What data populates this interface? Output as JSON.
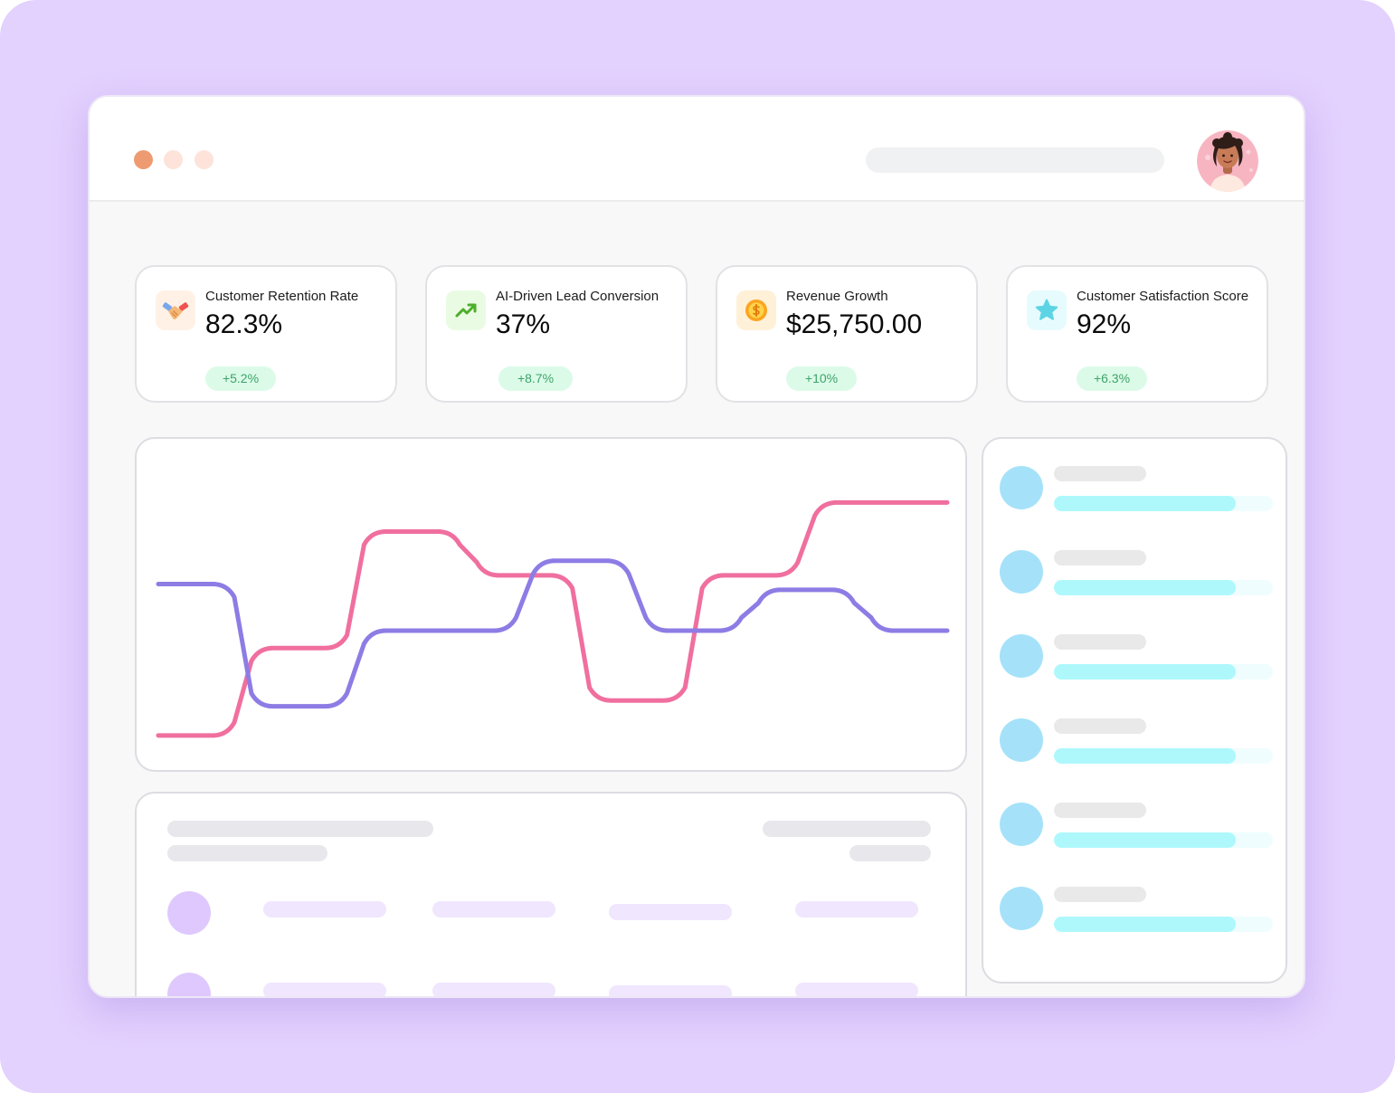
{
  "theme": {
    "background": "#e3d1fe",
    "accent_pink": "#f06f9f",
    "accent_purple": "#8e7ce5",
    "badge_bg": "#dbfbe8",
    "badge_text": "#3ea36b",
    "progress_fill": "#aef8fc",
    "avatar_circle": "#a5e2f9"
  },
  "header": {
    "window_controls": [
      "close",
      "minimize",
      "maximize"
    ],
    "avatar_icon": "user-avatar"
  },
  "kpis": [
    {
      "icon": "handshake-icon",
      "label": "Customer Retention Rate",
      "value": "82.3%",
      "change": "+5.2%"
    },
    {
      "icon": "trending-up-icon",
      "label": "AI-Driven Lead Conversion",
      "value": "37%",
      "change": "+8.7%"
    },
    {
      "icon": "coin-icon",
      "label": "Revenue Growth",
      "value": "$25,750.00",
      "change": "+10%"
    },
    {
      "icon": "star-icon",
      "label": "Customer Satisfaction Score",
      "value": "92%",
      "change": "+6.3%"
    }
  ],
  "chart_data": {
    "type": "line",
    "x": [
      0,
      1,
      2,
      3,
      4,
      5,
      6,
      7,
      8,
      9,
      10,
      11,
      12,
      13,
      14
    ],
    "series": [
      {
        "color": "#f06f9f",
        "values": [
          0,
          0,
          3,
          3,
          7,
          7,
          5.5,
          5.5,
          1.2,
          1.2,
          5.5,
          5.5,
          8,
          8,
          8
        ]
      },
      {
        "color": "#8e7ce5",
        "values": [
          5.2,
          5.2,
          1,
          1,
          3.6,
          3.6,
          3.6,
          6,
          6,
          3.6,
          3.6,
          5,
          5,
          3.6,
          3.6
        ]
      }
    ],
    "ylim": [
      -1,
      10
    ],
    "grid": false,
    "legend": "none"
  },
  "activity_list": {
    "items": [
      {
        "progress": 0.83
      },
      {
        "progress": 0.83
      },
      {
        "progress": 0.83
      },
      {
        "progress": 0.83
      },
      {
        "progress": 0.83
      },
      {
        "progress": 0.83
      }
    ]
  },
  "table": {
    "rows": 2,
    "columns": 4
  }
}
